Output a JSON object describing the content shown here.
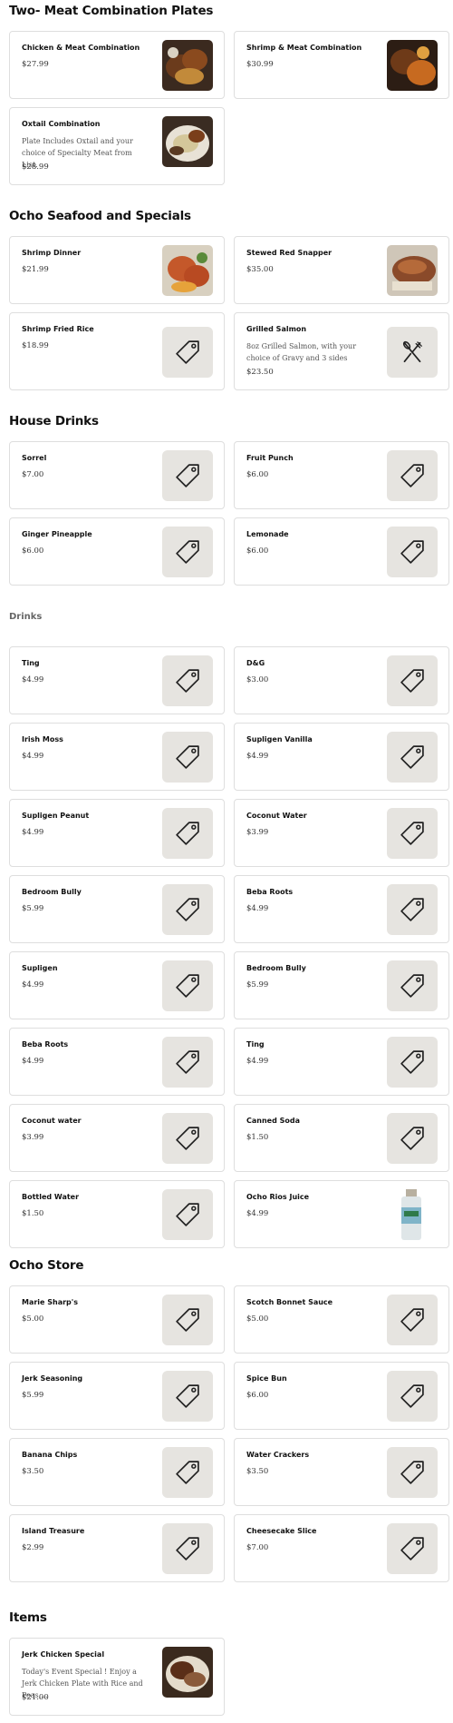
{
  "sections": {
    "two_meat": "Two- Meat Combination Plates",
    "seafood": "Ocho Seafood and Specials",
    "house_drinks": "House Drinks",
    "drinks": "Drinks",
    "store": "Ocho Store",
    "items": "Items"
  },
  "two_meat_items": [
    {
      "name": "Chicken & Meat Combination",
      "price": "$27.99"
    },
    {
      "name": "Shrimp & Meat Combination",
      "price": "$30.99"
    },
    {
      "name": "Oxtail Combination",
      "desc": "Plate Includes Oxtail and your choice of Specialty Meat from List.",
      "price": "$28.99"
    }
  ],
  "seafood_items": [
    {
      "name": "Shrimp Dinner",
      "price": "$21.99"
    },
    {
      "name": "Stewed Red Snapper",
      "price": "$35.00"
    },
    {
      "name": "Shrimp Fried Rice",
      "price": "$18.99"
    },
    {
      "name": "Grilled Salmon",
      "desc": "8oz Grilled Salmon, with your choice of Gravy and 3 sides",
      "price": "$23.50"
    }
  ],
  "house_drinks_items": [
    {
      "name": "Sorrel",
      "price": "$7.00"
    },
    {
      "name": "Fruit Punch",
      "price": "$6.00"
    },
    {
      "name": "Ginger Pineapple",
      "price": "$6.00"
    },
    {
      "name": "Lemonade",
      "price": "$6.00"
    }
  ],
  "drinks_items": [
    {
      "name": "Ting",
      "price": "$4.99"
    },
    {
      "name": "D&G",
      "price": "$3.00"
    },
    {
      "name": "Irish Moss",
      "price": "$4.99"
    },
    {
      "name": "Supligen Vanilla",
      "price": "$4.99"
    },
    {
      "name": "Supligen Peanut",
      "price": "$4.99"
    },
    {
      "name": "Coconut Water",
      "price": "$3.99"
    },
    {
      "name": "Bedroom Bully",
      "price": "$5.99"
    },
    {
      "name": "Beba Roots",
      "price": "$4.99"
    },
    {
      "name": "Supligen",
      "price": "$4.99"
    },
    {
      "name": "Bedroom Bully",
      "price": "$5.99"
    },
    {
      "name": "Beba Roots",
      "price": "$4.99"
    },
    {
      "name": "Ting",
      "price": "$4.99"
    },
    {
      "name": "Coconut water",
      "price": "$3.99"
    },
    {
      "name": "Canned Soda",
      "price": "$1.50"
    },
    {
      "name": "Bottled Water",
      "price": "$1.50"
    },
    {
      "name": "Ocho Rios Juice",
      "price": "$4.99"
    }
  ],
  "store_items": [
    {
      "name": "Marie Sharp's",
      "price": "$5.00"
    },
    {
      "name": "Scotch Bonnet Sauce",
      "price": "$5.00"
    },
    {
      "name": "Jerk Seasoning",
      "price": "$5.99"
    },
    {
      "name": "Spice Bun",
      "price": "$6.00"
    },
    {
      "name": "Banana Chips",
      "price": "$3.50"
    },
    {
      "name": "Water Crackers",
      "price": "$3.50"
    },
    {
      "name": "Island Treasure",
      "price": "$2.99"
    },
    {
      "name": "Cheesecake Slice",
      "price": "$7.00"
    }
  ],
  "items_items": [
    {
      "name": "Jerk Chicken Special",
      "desc": "Today's Event Special ! Enjoy a Jerk Chicken Plate with Rice and Peas,...",
      "price": "$21.00"
    }
  ],
  "icons": {
    "tag": "price-tag-icon",
    "utensils": "fork-knife-icon"
  },
  "colors": {
    "placeholder_bg": "#e6e4e0",
    "card_border": "#dedede",
    "muted_heading": "#666666"
  }
}
